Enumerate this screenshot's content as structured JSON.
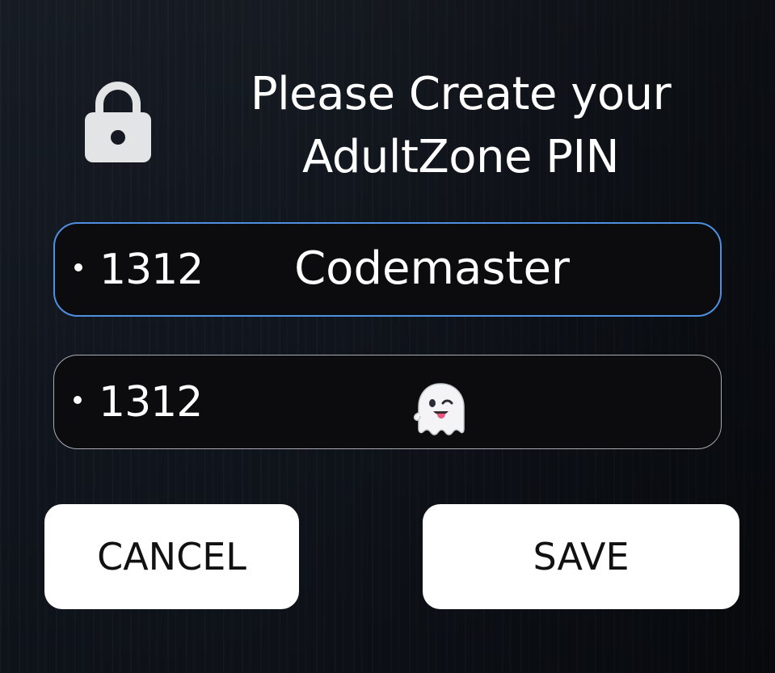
{
  "dialog": {
    "title_line1": "Please Create your",
    "title_line2": "AdultZone PIN",
    "lock_icon": "lock-icon"
  },
  "fields": [
    {
      "bullet": "•",
      "value": "1312",
      "label": "Codemaster",
      "focused": true,
      "border_color": "#4f8fe0"
    },
    {
      "bullet": "•",
      "value": "1312",
      "label_icon": "winking-ghost-emoji",
      "focused": false,
      "border_color": "#a9acb2"
    }
  ],
  "buttons": {
    "cancel": "CANCEL",
    "save": "SAVE"
  }
}
